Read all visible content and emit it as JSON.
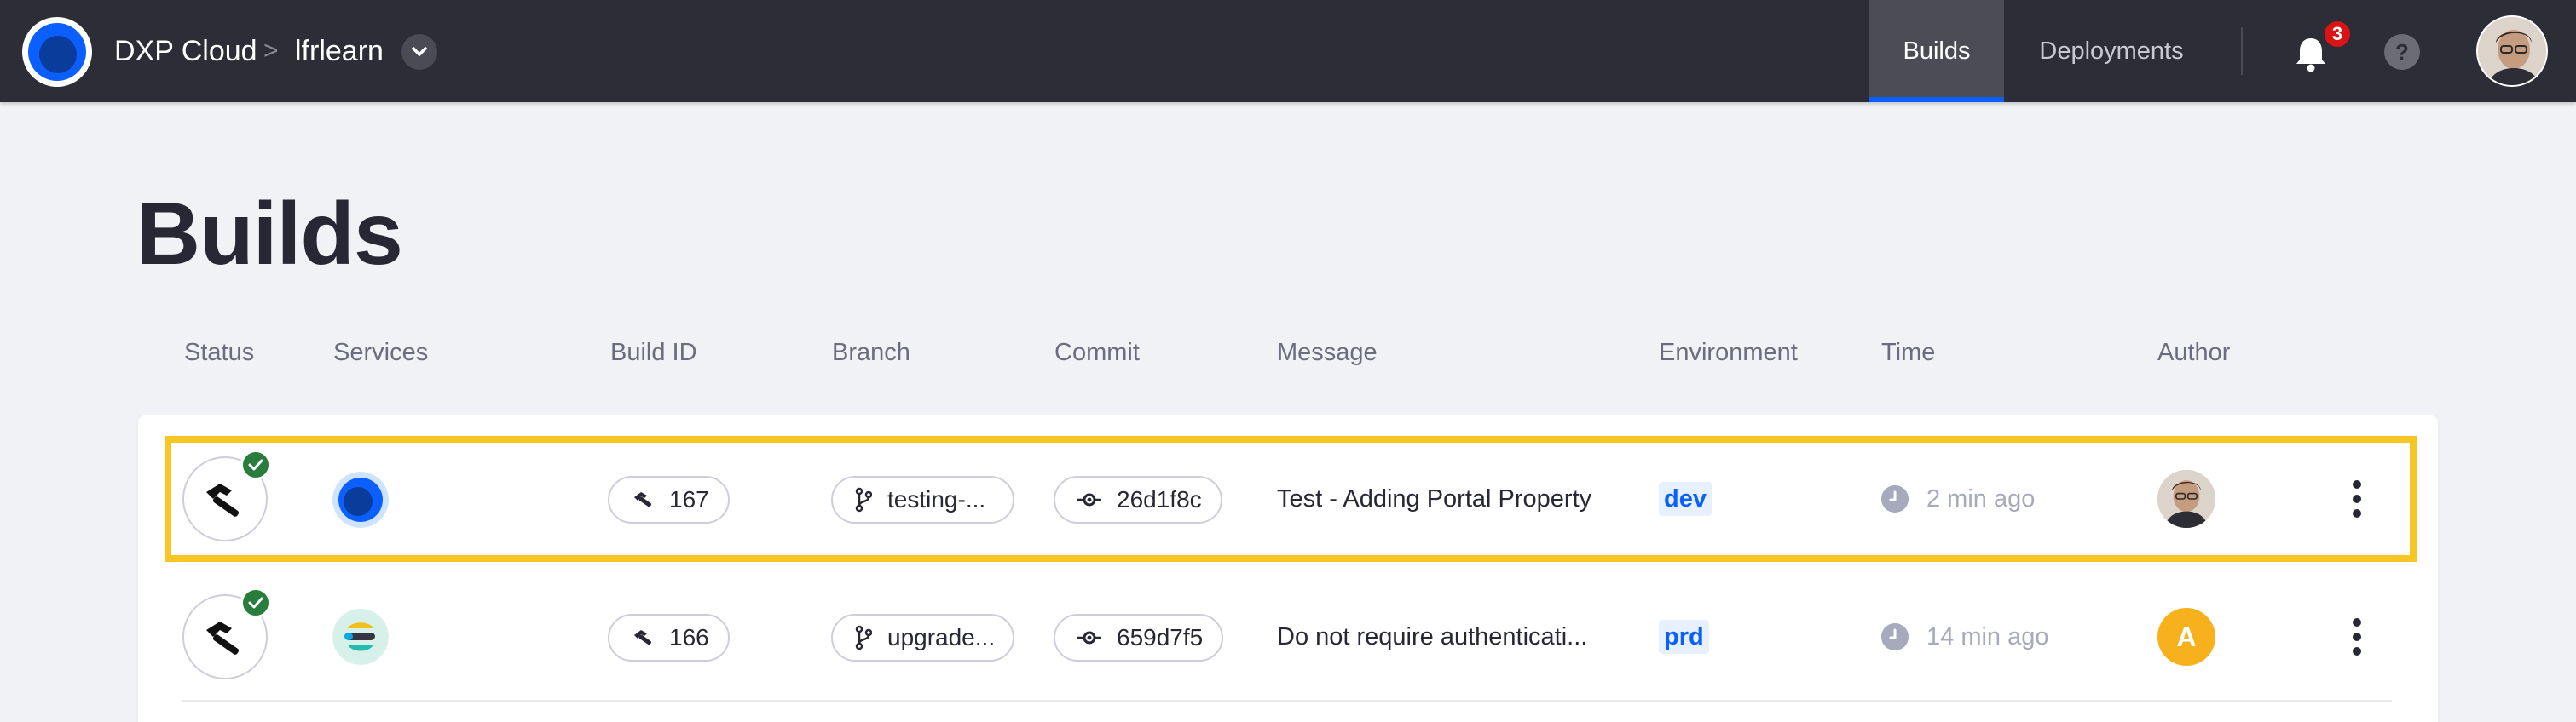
{
  "header": {
    "brand": "DXP Cloud",
    "breadcrumb_separator": ">",
    "project": "lfrlearn",
    "tabs": [
      {
        "label": "Builds",
        "active": true
      },
      {
        "label": "Deployments",
        "active": false
      }
    ],
    "notification_count": "3",
    "help_label": "?"
  },
  "page": {
    "title": "Builds"
  },
  "table": {
    "columns": [
      "Status",
      "Services",
      "Build ID",
      "Branch",
      "Commit",
      "Message",
      "Environment",
      "Time",
      "Author"
    ],
    "rows": [
      {
        "status": "success",
        "service": "liferay-icon",
        "build_id": "167",
        "branch": "testing-...",
        "commit": "26d1f8c",
        "message": "Test - Adding Portal Property",
        "environment": "dev",
        "time": "2 min ago",
        "author_type": "photo",
        "highlighted": true
      },
      {
        "status": "success",
        "service": "elasticsearch-icon",
        "build_id": "166",
        "branch": "upgrade...",
        "commit": "659d7f5",
        "message": "Do not require authenticati...",
        "environment": "prd",
        "time": "14 min ago",
        "author_type": "initial",
        "author_initial": "A",
        "highlighted": false
      }
    ]
  },
  "colors": {
    "topbar": "#2c2d36",
    "accent": "#0b5fff",
    "success": "#287d3c",
    "highlight": "#f7c624",
    "badge": "#da1414",
    "author_initial_bg": "#f6b11c"
  }
}
